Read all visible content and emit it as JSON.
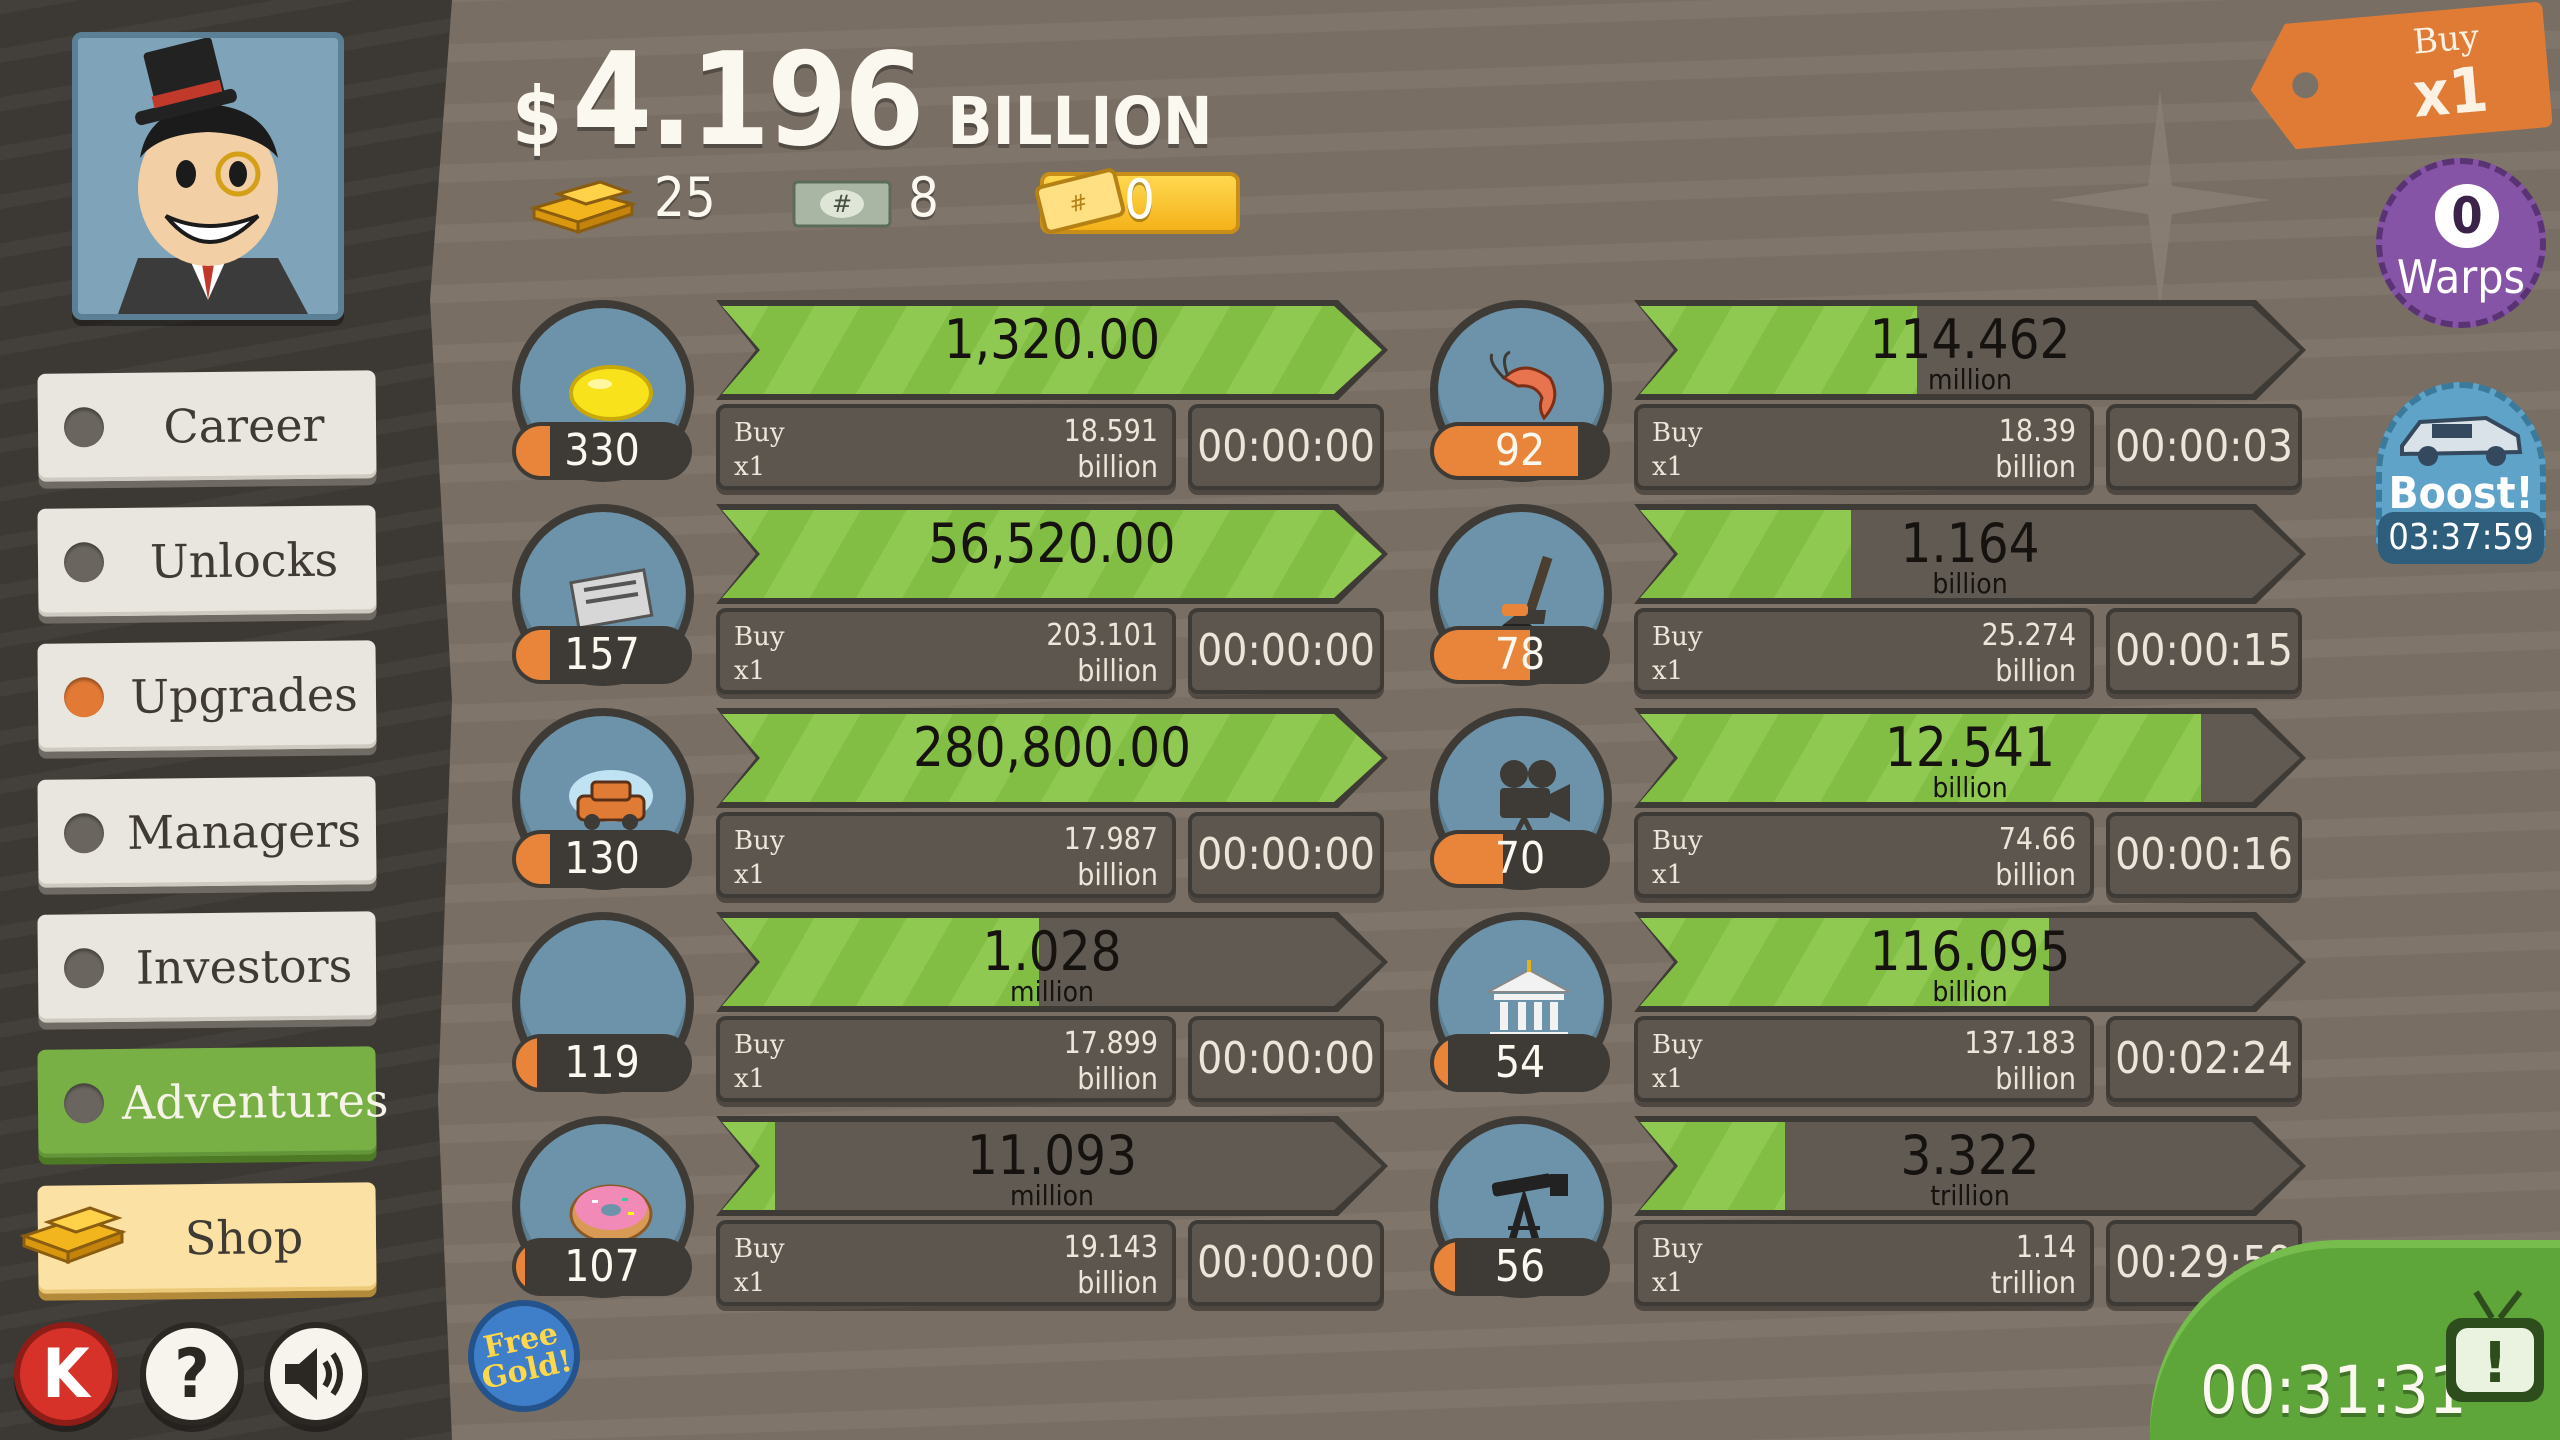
{
  "header": {
    "money_symbol": "$",
    "money_amount": "4.196",
    "money_unit": "BILLION",
    "gold_bars": "25",
    "angel_cards": "8",
    "tickets": "0"
  },
  "sidebar": {
    "items": [
      {
        "label": "Career"
      },
      {
        "label": "Unlocks"
      },
      {
        "label": "Upgrades"
      },
      {
        "label": "Managers"
      },
      {
        "label": "Investors"
      },
      {
        "label": "Adventures"
      },
      {
        "label": "Shop"
      }
    ],
    "k_label": "K",
    "help_label": "?"
  },
  "businesses": [
    {
      "icon": "lemon-icon",
      "count": "330",
      "count_fill": 0.2,
      "revenue": "1,320.00",
      "revenue_unit": "",
      "progress": 1.0,
      "buy_label_1": "Buy",
      "buy_label_2": "x1",
      "cost": "18.591",
      "cost_unit": "billion",
      "timer": "00:00:00"
    },
    {
      "icon": "newspaper-icon",
      "count": "157",
      "count_fill": 0.2,
      "revenue": "56,520.00",
      "revenue_unit": "",
      "progress": 1.0,
      "buy_label_1": "Buy",
      "buy_label_2": "x1",
      "cost": "203.101",
      "cost_unit": "billion",
      "timer": "00:00:00"
    },
    {
      "icon": "car-wash-icon",
      "count": "130",
      "count_fill": 0.2,
      "revenue": "280,800.00",
      "revenue_unit": "",
      "progress": 1.0,
      "buy_label_1": "Buy",
      "buy_label_2": "x1",
      "cost": "17.987",
      "cost_unit": "billion",
      "timer": "00:00:00"
    },
    {
      "icon": "pizza-icon",
      "count": "119",
      "count_fill": 0.12,
      "revenue": "1.028",
      "revenue_unit": "million",
      "progress": 0.48,
      "buy_label_1": "Buy",
      "buy_label_2": "x1",
      "cost": "17.899",
      "cost_unit": "billion",
      "timer": "00:00:00"
    },
    {
      "icon": "donut-icon",
      "count": "107",
      "count_fill": 0.05,
      "revenue": "11.093",
      "revenue_unit": "million",
      "progress": 0.08,
      "buy_label_1": "Buy",
      "buy_label_2": "x1",
      "cost": "19.143",
      "cost_unit": "billion",
      "timer": "00:00:00"
    },
    {
      "icon": "shrimp-icon",
      "count": "92",
      "count_fill": 0.84,
      "revenue": "114.462",
      "revenue_unit": "million",
      "progress": 0.42,
      "buy_label_1": "Buy",
      "buy_label_2": "x1",
      "cost": "18.39",
      "cost_unit": "billion",
      "timer": "00:00:03"
    },
    {
      "icon": "hockey-icon",
      "count": "78",
      "count_fill": 0.56,
      "revenue": "1.164",
      "revenue_unit": "billion",
      "progress": 0.32,
      "buy_label_1": "Buy",
      "buy_label_2": "x1",
      "cost": "25.274",
      "cost_unit": "billion",
      "timer": "00:00:15"
    },
    {
      "icon": "movie-camera-icon",
      "count": "70",
      "count_fill": 0.4,
      "revenue": "12.541",
      "revenue_unit": "billion",
      "progress": 0.85,
      "buy_label_1": "Buy",
      "buy_label_2": "x1",
      "cost": "74.66",
      "cost_unit": "billion",
      "timer": "00:00:16"
    },
    {
      "icon": "bank-icon",
      "count": "54",
      "count_fill": 0.08,
      "revenue": "116.095",
      "revenue_unit": "billion",
      "progress": 0.62,
      "buy_label_1": "Buy",
      "buy_label_2": "x1",
      "cost": "137.183",
      "cost_unit": "billion",
      "timer": "00:02:24"
    },
    {
      "icon": "oil-rig-icon",
      "count": "56",
      "count_fill": 0.12,
      "revenue": "3.322",
      "revenue_unit": "trillion",
      "progress": 0.22,
      "buy_label_1": "Buy",
      "buy_label_2": "x1",
      "cost": "1.14",
      "cost_unit": "trillion",
      "timer": "00:29:59"
    }
  ],
  "buy_multiplier": {
    "label": "Buy",
    "value": "x1"
  },
  "warps": {
    "count": "0",
    "label": "Warps"
  },
  "boost": {
    "label": "Boost!",
    "time": "03:37:59"
  },
  "tv": {
    "time": "00:31:31",
    "label": "!"
  },
  "free_gold": {
    "line1": "Free",
    "line2": "Gold!"
  },
  "colors": {
    "accent_green": "#82be43",
    "accent_orange": "#e9853b",
    "panel": "#5d564e"
  }
}
